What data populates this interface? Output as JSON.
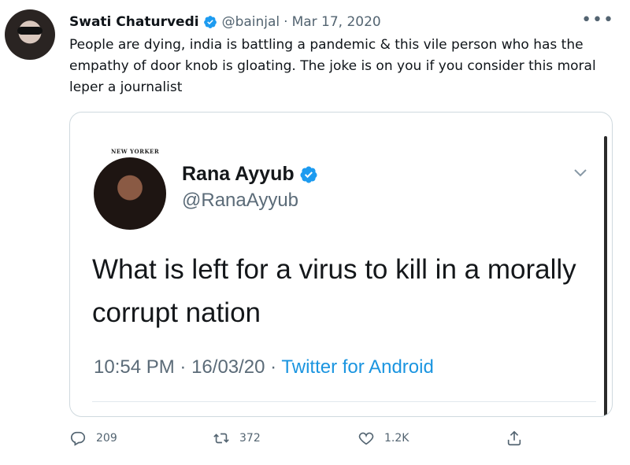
{
  "tweet": {
    "author_name": "Swati Chaturvedi",
    "handle": "@bainjal",
    "separator": "·",
    "date": "Mar 17, 2020",
    "more": "•••",
    "text": "People are dying, india is battling a pandemic & this vile person who has the empathy of door knob is gloating. The joke is on you if you consider this moral leper a journalist"
  },
  "quoted": {
    "logo": "NEW YORKER",
    "author_name": "Rana Ayyub",
    "handle": "@RanaAyyub",
    "text": "What is left for a virus to kill in a morally corrupt nation",
    "time": "10:54 PM",
    "date": "16/03/20",
    "separator": "·",
    "source": "Twitter for Android"
  },
  "actions": {
    "replies": "209",
    "retweets": "372",
    "likes": "1.2K"
  },
  "icons": {
    "verified": "verified-badge-icon",
    "reply": "reply-icon",
    "retweet": "retweet-icon",
    "like": "heart-icon",
    "share": "share-icon",
    "chevron": "chevron-down-icon"
  },
  "colors": {
    "accent": "#1d9bf0",
    "secondary_text": "#536471",
    "source_link": "#1b95e0"
  }
}
